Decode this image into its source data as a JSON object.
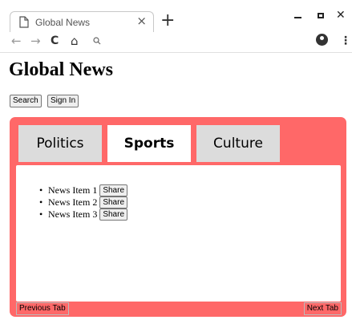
{
  "browser": {
    "tab_title": "Global News",
    "tab_close": "×",
    "new_tab": "+",
    "icons": {
      "tab": "document-icon",
      "back": "arrow-left-icon",
      "forward": "arrow-right-icon",
      "reload": "reload-icon",
      "home": "home-icon",
      "search": "search-icon",
      "profile": "account-icon",
      "menu": "kebab-menu-icon"
    }
  },
  "page": {
    "title": "Global News",
    "buttons": {
      "search": "Search",
      "sign_in": "Sign In"
    }
  },
  "panel": {
    "accent_color": "#ff6868",
    "tabs": [
      {
        "label": "Politics",
        "active": false
      },
      {
        "label": "Sports",
        "active": true
      },
      {
        "label": "Culture",
        "active": false
      }
    ],
    "news": [
      {
        "label": "News Item 1",
        "action": "Share"
      },
      {
        "label": "News Item 2",
        "action": "Share"
      },
      {
        "label": "News Item 3",
        "action": "Share"
      }
    ],
    "prev_label": "Previous Tab",
    "next_label": "Next Tab"
  }
}
